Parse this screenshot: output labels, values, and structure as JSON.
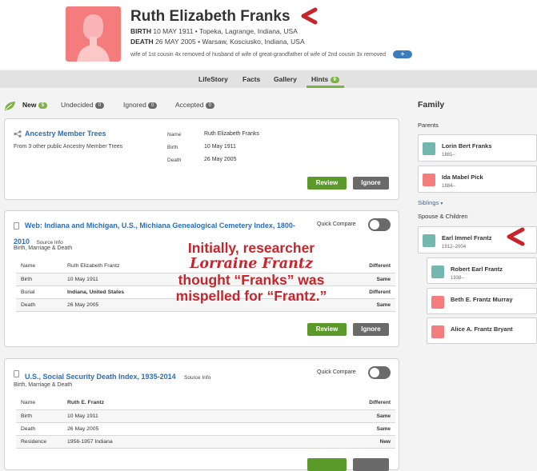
{
  "person": {
    "name": "Ruth Elizabeth Franks",
    "birth_label": "BIRTH",
    "birth_value": "10 MAY 1911 • Topeka, Lagrange, Indiana, USA",
    "death_label": "DEATH",
    "death_value": "26 MAY 2005 • Warsaw, Kosciusko, Indiana, USA",
    "relationship": "wife of 1st cousin 4x removed of husband of wife of great-grandfather of wife of 2nd cousin 3x removed",
    "relationship_button": "+"
  },
  "tabs": [
    {
      "label": "LifeStory"
    },
    {
      "label": "Facts"
    },
    {
      "label": "Gallery"
    },
    {
      "label": "Hints",
      "count": "9"
    }
  ],
  "subtabs": [
    {
      "label": "New",
      "count": "5"
    },
    {
      "label": "Undecided",
      "count": "0"
    },
    {
      "label": "Ignored",
      "count": "0"
    },
    {
      "label": "Accepted",
      "count": "0"
    }
  ],
  "card1": {
    "title": "Ancestry Member Trees",
    "subtitle": "From 3 other public Ancestry Member Trees",
    "fields": [
      {
        "label": "Name",
        "value": "Ruth Elizabeth Franks"
      },
      {
        "label": "Birth",
        "value": "10 May 1911"
      },
      {
        "label": "Death",
        "value": "26 May 2005"
      }
    ],
    "review": "Review",
    "ignore": "Ignore"
  },
  "card2": {
    "title": "Web: Indiana and Michigan, U.S., Michiana Genealogical Cemetery Index, 1800-",
    "title2": "2010",
    "source": "Source Info",
    "subtitle": "Birth, Marriage & Death",
    "quick_compare": "Quick Compare",
    "rows": [
      {
        "label": "Name",
        "value": "Ruth Elizabeth Frantz",
        "status": "Different"
      },
      {
        "label": "Birth",
        "value": "10 May 1911",
        "status": "Same"
      },
      {
        "label": "Burial",
        "value": "Indiana, United States",
        "status": "Different"
      },
      {
        "label": "Death",
        "value": "26 May 2005",
        "status": "Same"
      }
    ],
    "review": "Review",
    "ignore": "Ignore"
  },
  "card3": {
    "title": "U.S., Social Security Death Index, 1935-2014",
    "source": "Source Info",
    "subtitle": "Birth, Marriage & Death",
    "quick_compare": "Quick Compare",
    "rows": [
      {
        "label": "Name",
        "value": "Ruth E. Frantz",
        "status": "Different"
      },
      {
        "label": "Birth",
        "value": "10 May 1911",
        "status": "Same"
      },
      {
        "label": "Death",
        "value": "26 May 2005",
        "status": "Same"
      },
      {
        "label": "Residence",
        "value": "1956-1957 Indiana",
        "status": "New"
      }
    ]
  },
  "annotation": {
    "line1": "Initially, researcher",
    "line2": "Lorraine Frantz",
    "line3": "thought “Franks” was",
    "line4": "mispelled for “Frantz.”"
  },
  "family": {
    "title": "Family",
    "parents_label": "Parents",
    "parents": [
      {
        "name": "Lorin Bert Franks",
        "dates": "1881–"
      },
      {
        "name": "Ida Mabel Pick",
        "dates": "1884–"
      }
    ],
    "siblings_label": "Siblings",
    "spouse_label": "Spouse & Children",
    "spouse": {
      "name": "Earl Immel Frantz",
      "dates": "1912–2004"
    },
    "children": [
      {
        "name": "Robert Earl Frantz",
        "dates": "1938–"
      },
      {
        "name": "Beth E. Frantz Murray",
        "dates": ""
      },
      {
        "name": "Alice A. Frantz Bryant",
        "dates": ""
      }
    ]
  },
  "colors": {
    "accent_green": "#7cb342",
    "link_blue": "#2a6ebb",
    "female": "#f47c7c",
    "male": "#74b6b0",
    "annotation_red": "#c8242b"
  }
}
